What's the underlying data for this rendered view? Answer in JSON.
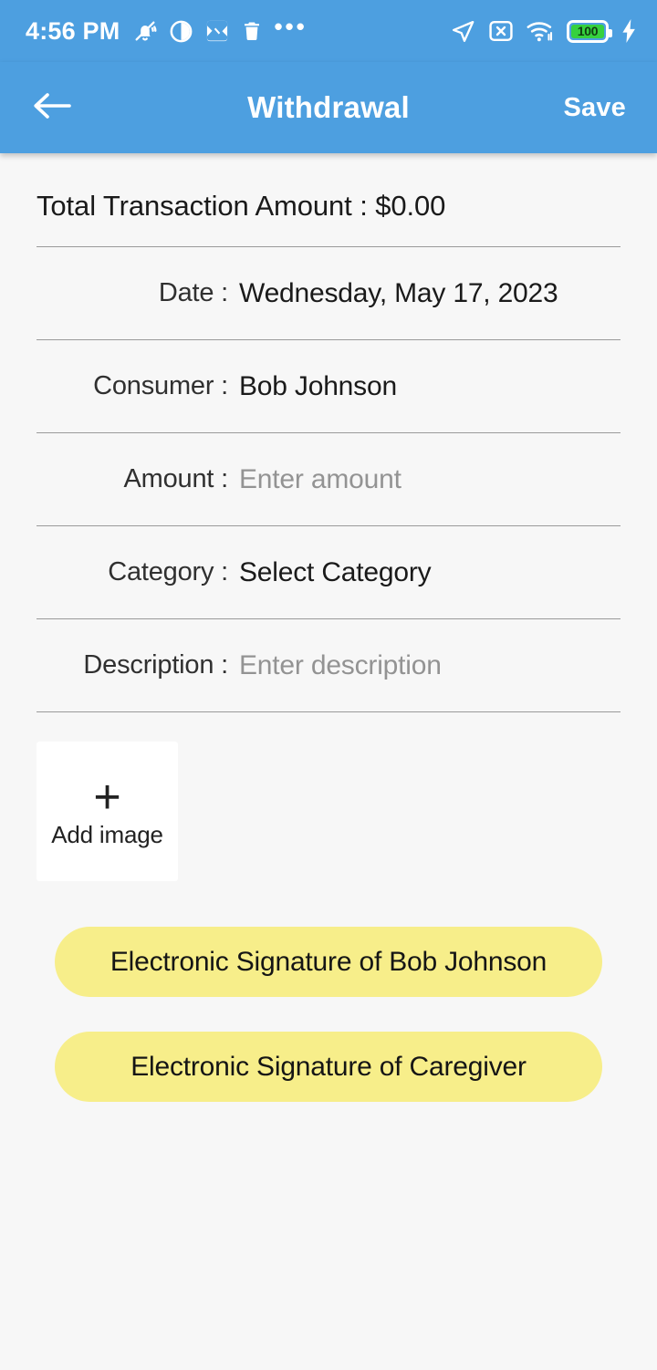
{
  "status_bar": {
    "time": "4:56 PM",
    "battery_level": "100",
    "left_icons": [
      "bell-muted-icon",
      "brightness-half-icon",
      "image-broken-icon",
      "trash-icon",
      "overflow-dots-icon"
    ],
    "right_icons": [
      "location-arrow-icon",
      "sim-x-icon",
      "wifi-icon",
      "battery-icon",
      "charging-bolt-icon"
    ],
    "colors": {
      "background": "#4d9fe0",
      "battery_fill": "#36d13e"
    }
  },
  "app_bar": {
    "back_icon": "arrow-left-icon",
    "title": "Withdrawal",
    "save_label": "Save",
    "background": "#4d9fe0"
  },
  "content": {
    "total_transaction": "Total Transaction Amount : $0.00",
    "fields": [
      {
        "label": "Date :",
        "value": "Wednesday, May 17, 2023",
        "is_placeholder": false
      },
      {
        "label": "Consumer :",
        "value": "Bob Johnson",
        "is_placeholder": false
      },
      {
        "label": "Amount :",
        "value": "Enter amount",
        "is_placeholder": true
      },
      {
        "label": "Category :",
        "value": "Select Category",
        "is_placeholder": false
      },
      {
        "label": "Description :",
        "value": "Enter description",
        "is_placeholder": true
      }
    ],
    "add_image": {
      "icon": "plus-icon",
      "label": "Add image"
    },
    "signature_buttons": [
      {
        "label": "Electronic Signature of Bob Johnson"
      },
      {
        "label": "Electronic Signature of Caregiver"
      }
    ],
    "colors": {
      "page_background": "#f7f7f7",
      "divider": "#9a9a9a",
      "placeholder_text": "#939393",
      "signature_button": "#f7ee8a",
      "card_background": "#ffffff"
    }
  }
}
